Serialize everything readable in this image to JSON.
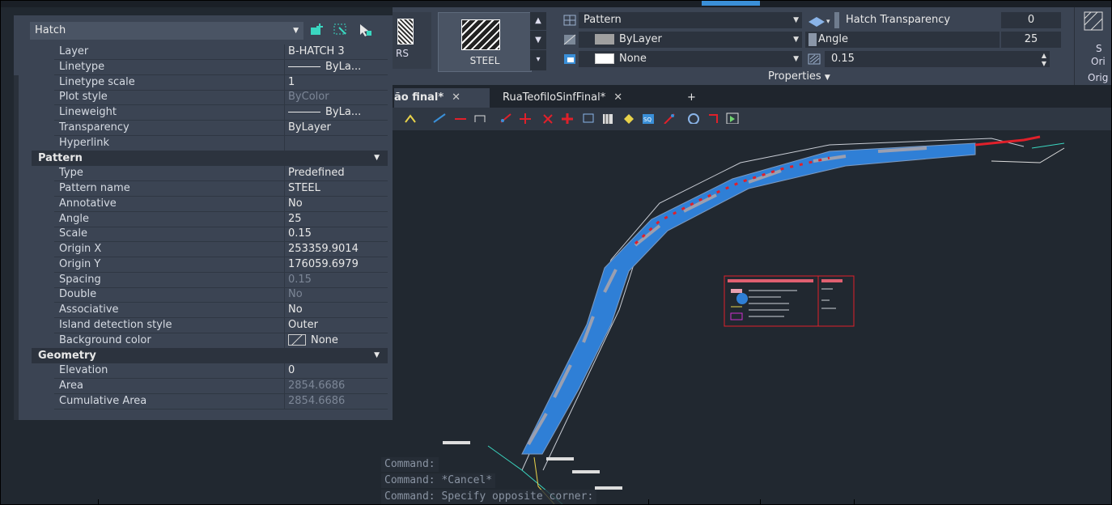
{
  "palette": {
    "selector": "Hatch",
    "general_rows": [
      {
        "key": "Layer",
        "value": "B-HATCH 3"
      },
      {
        "key": "Linetype",
        "value": "ByLa...",
        "line": true
      },
      {
        "key": "Linetype scale",
        "value": "1"
      },
      {
        "key": "Plot style",
        "value": "ByColor",
        "dim": true
      },
      {
        "key": "Lineweight",
        "value": "ByLa...",
        "line": true
      },
      {
        "key": "Transparency",
        "value": "ByLayer"
      },
      {
        "key": "Hyperlink",
        "value": ""
      }
    ],
    "pattern_section": "Pattern",
    "pattern_rows": [
      {
        "key": "Type",
        "value": "Predefined"
      },
      {
        "key": "Pattern name",
        "value": "STEEL"
      },
      {
        "key": "Annotative",
        "value": "No"
      },
      {
        "key": "Angle",
        "value": "25"
      },
      {
        "key": "Scale",
        "value": "0.15"
      },
      {
        "key": "Origin X",
        "value": "253359.9014"
      },
      {
        "key": "Origin Y",
        "value": "176059.6979"
      },
      {
        "key": "Spacing",
        "value": "0.15",
        "dim": true
      },
      {
        "key": "Double",
        "value": "No",
        "dim": true
      },
      {
        "key": "Associative",
        "value": "No"
      },
      {
        "key": "Island detection style",
        "value": "Outer"
      },
      {
        "key": "Background color",
        "value": "None",
        "swatch": true
      }
    ],
    "geometry_section": "Geometry",
    "geometry_rows": [
      {
        "key": "Elevation",
        "value": "0"
      },
      {
        "key": "Area",
        "value": "2854.6686",
        "dim": true
      },
      {
        "key": "Cumulative Area",
        "value": "2854.6686",
        "dim": true
      }
    ]
  },
  "ribbon": {
    "gallery_left_label": "RS",
    "gallery_selected_label": "STEEL",
    "pattern_dropdown": "Pattern",
    "color_dropdown": "ByLayer",
    "bgcolor_dropdown": "None",
    "transparency_label": "Hatch Transparency",
    "transparency_value": "0",
    "angle_label": "Angle",
    "angle_value": "25",
    "scale_value": "0.15",
    "properties_title": "Properties",
    "origin_label_1": "S",
    "origin_label_2": "Ori",
    "origin_title": "Orig"
  },
  "tabs": [
    {
      "label": "ão final*"
    },
    {
      "label": "RuaTeofiloSinfFinal*"
    }
  ],
  "new_tab": "+",
  "tab_close": "✕",
  "command_lines": [
    "Command:",
    "Command: *Cancel*",
    "Command: Specify opposite corner:"
  ],
  "colors": {
    "hatch": "#2f7fd6",
    "accent_red": "#e0202a",
    "panel": "#3b4453"
  }
}
